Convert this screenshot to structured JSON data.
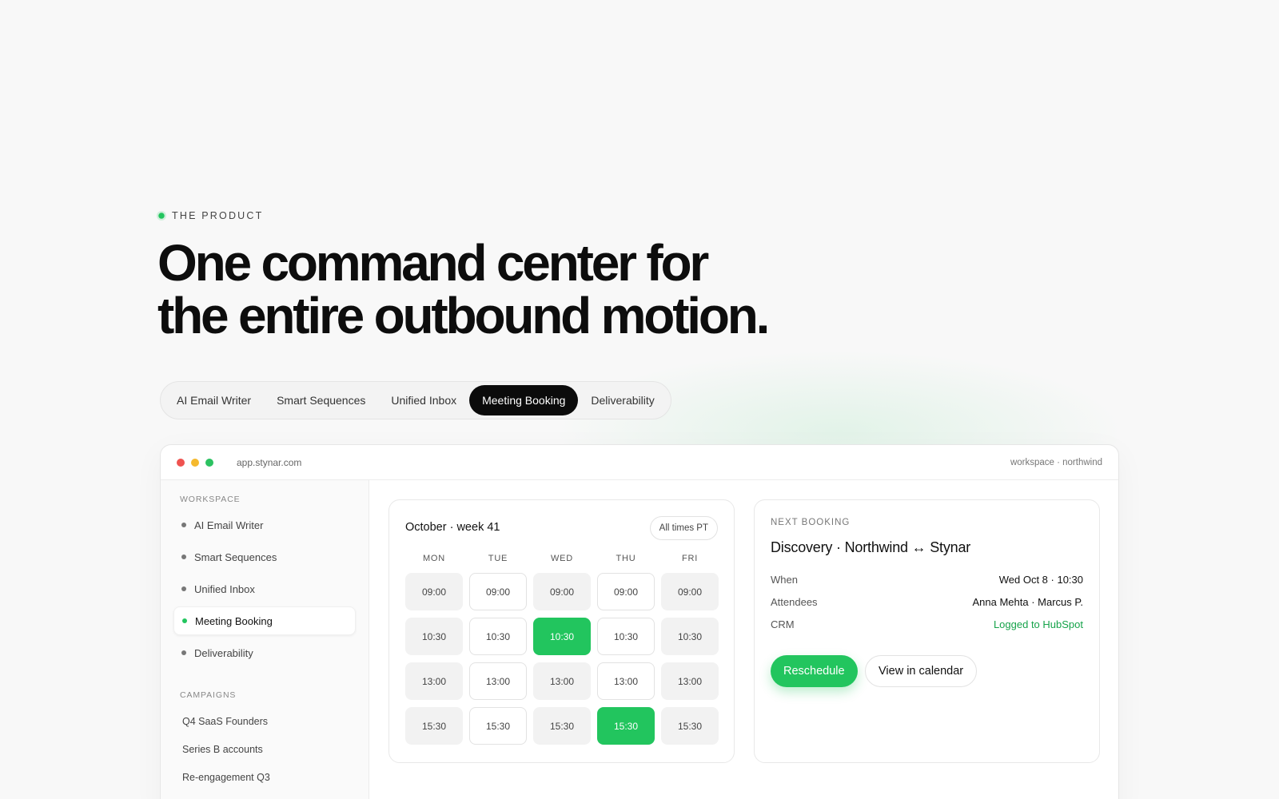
{
  "hero": {
    "eyebrow": "THE PRODUCT",
    "headline_line1": "One command center for",
    "headline_line2": "the entire outbound motion."
  },
  "tabs": [
    {
      "label": "AI Email Writer",
      "active": false
    },
    {
      "label": "Smart Sequences",
      "active": false
    },
    {
      "label": "Unified Inbox",
      "active": false
    },
    {
      "label": "Meeting Booking",
      "active": true
    },
    {
      "label": "Deliverability",
      "active": false
    }
  ],
  "window": {
    "url": "app.stynar.com",
    "workspace": "workspace · northwind"
  },
  "sidebar": {
    "workspace_label": "WORKSPACE",
    "items": [
      {
        "label": "AI Email Writer"
      },
      {
        "label": "Smart Sequences"
      },
      {
        "label": "Unified Inbox"
      },
      {
        "label": "Meeting Booking"
      },
      {
        "label": "Deliverability"
      }
    ],
    "active_item": "Meeting Booking",
    "campaigns_label": "CAMPAIGNS",
    "campaigns": [
      {
        "label": "Q4 SaaS Founders"
      },
      {
        "label": "Series B accounts"
      },
      {
        "label": "Re-engagement Q3"
      }
    ]
  },
  "calendar": {
    "title": "October · week 41",
    "timezone": "All times PT",
    "days": [
      "MON",
      "TUE",
      "WED",
      "THU",
      "FRI"
    ],
    "rows": [
      {
        "time": "09:00",
        "states": [
          "busy",
          "open",
          "busy",
          "open",
          "busy"
        ]
      },
      {
        "time": "10:30",
        "states": [
          "busy",
          "open",
          "booked",
          "open",
          "busy"
        ]
      },
      {
        "time": "13:00",
        "states": [
          "busy",
          "open",
          "busy",
          "open",
          "busy"
        ]
      },
      {
        "time": "15:30",
        "states": [
          "busy",
          "open",
          "busy",
          "booked",
          "busy"
        ]
      }
    ]
  },
  "booking": {
    "label": "NEXT BOOKING",
    "title": "Discovery · Northwind ↔ Stynar",
    "when_label": "When",
    "when_value": "Wed Oct 8 · 10:30",
    "attendees_label": "Attendees",
    "attendees_value": "Anna Mehta · Marcus P.",
    "crm_label": "CRM",
    "crm_value": "Logged to HubSpot",
    "reschedule": "Reschedule",
    "view_calendar": "View in calendar"
  },
  "colors": {
    "accent": "#22c55e",
    "dark": "#0b0b0b",
    "background": "#f8f8f8"
  }
}
